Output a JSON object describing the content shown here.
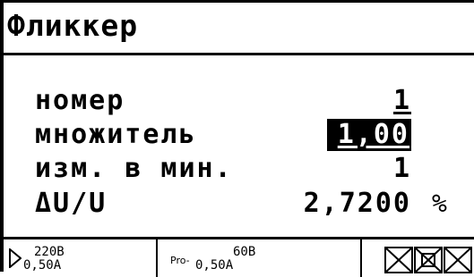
{
  "header": {
    "title": "Фликкер"
  },
  "rows": [
    {
      "label": "номер",
      "value": "1"
    },
    {
      "label": "множитель",
      "value": "1,00"
    },
    {
      "label": "изм. в мин.",
      "value": "1"
    },
    {
      "label": "ΔU/U",
      "value": "2,7200",
      "unit": "%"
    }
  ],
  "status": {
    "ch1": {
      "voltage": "220В",
      "current": "0,50А"
    },
    "ch2": {
      "prefix": "Pro-",
      "voltage": "60В",
      "current": "0,50А"
    },
    "icons": [
      "phase-box-icon",
      "phase-box-icon",
      "phase-box-icon"
    ]
  }
}
